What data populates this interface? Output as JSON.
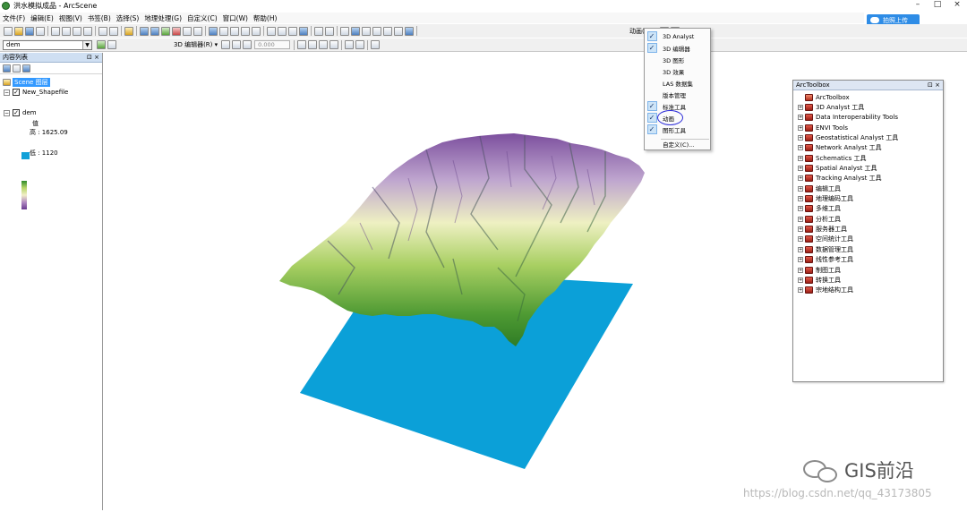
{
  "window": {
    "title": "洪水模拟成品 - ArcScene",
    "controls": [
      "–",
      "□",
      "×"
    ]
  },
  "cloud_button": {
    "label": "拍照上传"
  },
  "menus": [
    "文件(F)",
    "编辑(E)",
    "视图(V)",
    "书签(B)",
    "选择(S)",
    "地理处理(G)",
    "自定义(C)",
    "窗口(W)",
    "帮助(H)"
  ],
  "toolbar": {
    "animation_label": "动画(A) ▾",
    "layer_value": "dem",
    "editor_label": "3D 编辑器(R) ▾",
    "z_value": "0.000"
  },
  "toc": {
    "title": "内容列表",
    "pin": "⊡ ×",
    "scene_layers": "Scene 图层",
    "layers": [
      {
        "name": "New_Shapefile"
      },
      {
        "name": "dem",
        "legend_title": "值",
        "high": "高 : 1625.09",
        "low": "低 : 1120"
      }
    ]
  },
  "toolbox": {
    "title": "ArcToolbox",
    "pin": "⊡ ×",
    "root": "ArcToolbox",
    "items": [
      "3D Analyst 工具",
      "Data Interoperability Tools",
      "ENVI Tools",
      "Geostatistical Analyst 工具",
      "Network Analyst 工具",
      "Schematics 工具",
      "Spatial Analyst 工具",
      "Tracking Analyst 工具",
      "编辑工具",
      "地理编码工具",
      "多维工具",
      "分析工具",
      "服务器工具",
      "空间统计工具",
      "数据管理工具",
      "线性参考工具",
      "制图工具",
      "转换工具",
      "宗地结构工具"
    ]
  },
  "dropdown": {
    "items": [
      {
        "label": "3D Analyst",
        "checked": true
      },
      {
        "label": "3D 编辑器",
        "checked": true
      },
      {
        "label": "3D 图形",
        "checked": false
      },
      {
        "label": "3D 效果",
        "checked": false
      },
      {
        "label": "LAS 数据集",
        "checked": false
      },
      {
        "label": "版本管理",
        "checked": false
      },
      {
        "label": "标准工具",
        "checked": true
      },
      {
        "label": "动画",
        "checked": true
      },
      {
        "label": "图形工具",
        "checked": true
      }
    ],
    "customize": "自定义(C)..."
  },
  "watermark": {
    "brand": "GIS前沿",
    "url": "https://blog.csdn.net/qq_43173805"
  },
  "colors": {
    "water": "#0ba0d8",
    "dem_high": "#2d8a2a",
    "dem_low": "#6a3a90"
  }
}
